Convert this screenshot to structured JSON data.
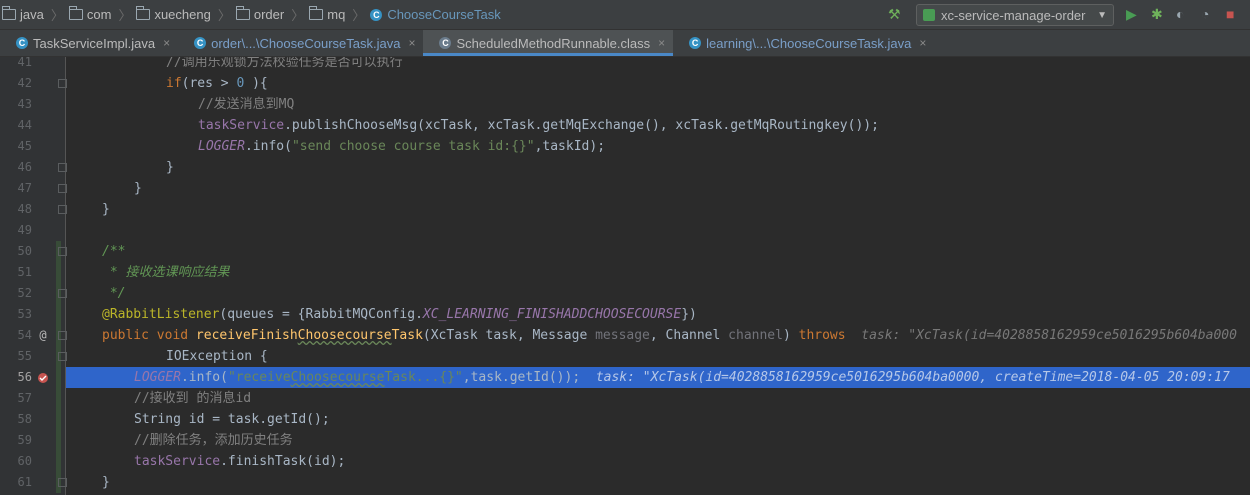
{
  "breadcrumbs": [
    "java",
    "com",
    "xuecheng",
    "order",
    "mq",
    "ChooseCourseTask"
  ],
  "run_config": {
    "label": "xc-service-manage-order"
  },
  "toolbar_icons": [
    "build-icon",
    "run-icon",
    "debug-icon",
    "coverage-icon",
    "profile-icon",
    "stop-icon"
  ],
  "tabs": [
    {
      "label": "TaskServiceImpl.java",
      "close": "×"
    },
    {
      "label": "order\\...\\ChooseCourseTask.java",
      "close": "×"
    },
    {
      "label": "ScheduledMethodRunnable.class",
      "close": "×"
    },
    {
      "label": "learning\\...\\ChooseCourseTask.java",
      "close": "×"
    }
  ],
  "line_numbers": [
    "41",
    "42",
    "43",
    "44",
    "45",
    "46",
    "47",
    "48",
    "49",
    "50",
    "51",
    "52",
    "53",
    "54",
    "55",
    "56",
    "57",
    "58",
    "59",
    "60",
    "61"
  ],
  "code": {
    "l41": "//调用乐观锁方法校验任务是否可以执行",
    "l42_kw": "if",
    "l42_a": "(res > ",
    "l42_num": "0",
    "l42_b": " ){",
    "l43": "//发送消息到MQ",
    "l44_a": "taskService",
    "l44_b": ".publishChooseMsg(xcTask, xcTask.getMqExchange(), xcTask.getMqRoutingkey());",
    "l45_a": "LOGGER",
    "l45_b": ".info(",
    "l45_str": "\"send choose course task id:{}\"",
    "l45_c": ",taskId);",
    "l46": "}",
    "l47": "}",
    "l48": "}",
    "l50": "/**",
    "l51": " * 接收选课响应结果",
    "l52": " */",
    "l53_ann": "@RabbitListener",
    "l53_a": "(queues = {RabbitMQConfig.",
    "l53_const": "XC_LEARNING_FINISHADDCHOOSECOURSE",
    "l53_b": "})",
    "l54_kw": "public void ",
    "l54_m1": "receiveFinish",
    "l54_m2": "Choosecourse",
    "l54_m3": "Task",
    "l54_a": "(XcTask task, Message ",
    "l54_p1": "message",
    "l54_c": ", Channel ",
    "l54_p2": "channel",
    "l54_d": ") ",
    "l54_throws": "throws",
    "l54_hint": "task: \"XcTask(id=4028858162959ce5016295b604ba000",
    "l55": "IOException {",
    "l56_a": "LOGGER",
    "l56_b": ".info(",
    "l56_s1": "\"receive",
    "l56_s2": "Choosecourse",
    "l56_s3": "Task...{}\"",
    "l56_c": ",task.getId());",
    "l56_hint": "task: \"XcTask(id=4028858162959ce5016295b604ba0000, createTime=2018-04-05 20:09:17",
    "l57": "//接收到 的消息id",
    "l58": "String id = task.getId();",
    "l59": "//删除任务，添加历史任务",
    "l60_a": "taskService",
    "l60_b": ".finishTask(id);",
    "l61": "}"
  },
  "gutter_marks": {
    "l54": "@",
    "l56": "breakpoint"
  },
  "colors": {
    "background": "#2b2b2b",
    "gutter": "#313335",
    "execution_line": "#2f65ca",
    "keyword": "#cc7832",
    "string": "#6a8759"
  }
}
